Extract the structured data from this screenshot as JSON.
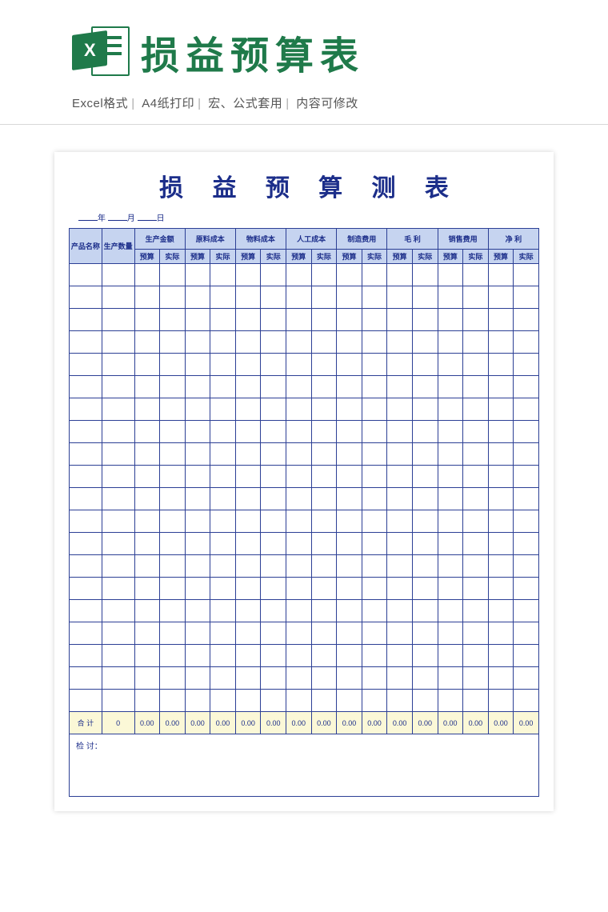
{
  "banner": {
    "title": "损益预算表",
    "icon_letter": "X",
    "features": [
      "Excel格式",
      "A4纸打印",
      "宏、公式套用",
      "内容可修改"
    ]
  },
  "sheet": {
    "title": "损 益 预 算 测 表",
    "date": {
      "year": "年",
      "month": "月",
      "day": "日"
    },
    "header": {
      "product_name": "产品名称",
      "production_qty": "生产数量",
      "groups": [
        "生产金额",
        "原料成本",
        "物料成本",
        "人工成本",
        "制造费用",
        "毛  利",
        "销售费用",
        "净  利"
      ],
      "sub_budget": "预算",
      "sub_actual": "实际"
    },
    "body_row_count": 20,
    "total": {
      "label": "合  计",
      "qty": "0",
      "cell": "0.00"
    },
    "review_label": "检 讨："
  }
}
